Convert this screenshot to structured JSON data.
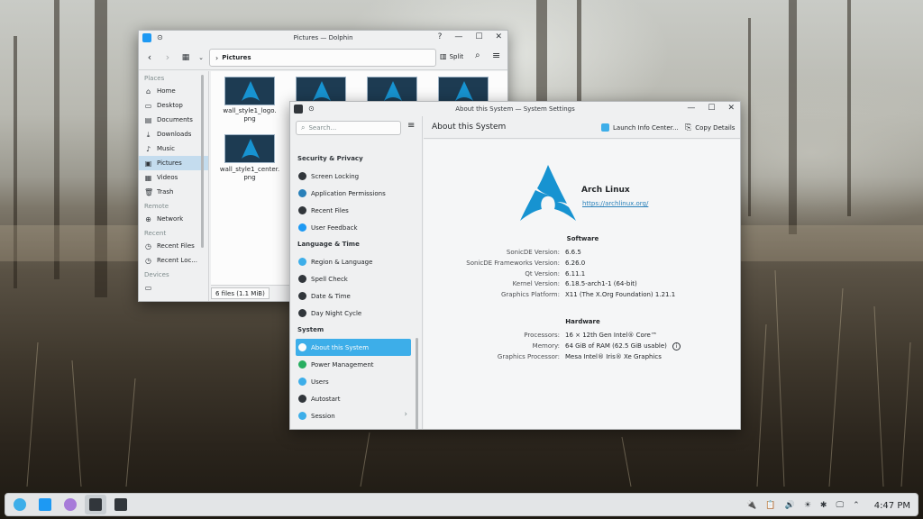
{
  "dolphin": {
    "title": "Pictures — Dolphin",
    "help": "?",
    "minimize": "—",
    "maximize": "☐",
    "close": "✕",
    "back": "‹",
    "forward": "›",
    "location": "Pictures",
    "split_label": "Split",
    "places": [
      {
        "type": "section",
        "label": "Places"
      },
      {
        "type": "item",
        "label": "Home",
        "icon": "home-icon",
        "glyph": "⌂"
      },
      {
        "type": "item",
        "label": "Desktop",
        "icon": "desktop-icon",
        "glyph": "▭"
      },
      {
        "type": "item",
        "label": "Documents",
        "icon": "documents-icon",
        "glyph": "▤"
      },
      {
        "type": "item",
        "label": "Downloads",
        "icon": "downloads-icon",
        "glyph": "⤓"
      },
      {
        "type": "item",
        "label": "Music",
        "icon": "music-icon",
        "glyph": "♪"
      },
      {
        "type": "item",
        "label": "Pictures",
        "icon": "pictures-icon",
        "glyph": "▣",
        "active": true
      },
      {
        "type": "item",
        "label": "Videos",
        "icon": "videos-icon",
        "glyph": "▦"
      },
      {
        "type": "item",
        "label": "Trash",
        "icon": "trash-icon",
        "glyph": "🗑"
      },
      {
        "type": "section",
        "label": "Remote"
      },
      {
        "type": "item",
        "label": "Network",
        "icon": "network-icon",
        "glyph": "⊕"
      },
      {
        "type": "section",
        "label": "Recent"
      },
      {
        "type": "item",
        "label": "Recent Files",
        "icon": "recent-files-icon",
        "glyph": "◷"
      },
      {
        "type": "item",
        "label": "Recent Loc...",
        "icon": "recent-locations-icon",
        "glyph": "◷"
      },
      {
        "type": "section",
        "label": "Devices"
      },
      {
        "type": "item",
        "label": "",
        "icon": "drive-icon",
        "glyph": "▭"
      }
    ],
    "files": [
      {
        "name": "wall_style1_logo.\npng"
      },
      {
        "name": ""
      },
      {
        "name": ""
      },
      {
        "name": ""
      },
      {
        "name": "wall_style1_center.\npng"
      }
    ],
    "status": "6 files (1.1 MiB)"
  },
  "settings": {
    "title": "About this System — System Settings",
    "minimize": "—",
    "maximize": "☐",
    "close": "✕",
    "search_placeholder": "Search...",
    "page_title": "About this System",
    "launch_info": "Launch Info Center...",
    "copy_details": "Copy Details",
    "sidebar": [
      {
        "type": "cat",
        "label": "Security & Privacy"
      },
      {
        "type": "item",
        "label": "Screen Locking",
        "name": "screen-locking",
        "icon": "screen-lock-icon",
        "color": "#31363b"
      },
      {
        "type": "item",
        "label": "Application Permissions",
        "name": "application-permissions",
        "icon": "shield-icon",
        "color": "#2980b9"
      },
      {
        "type": "item",
        "label": "Recent Files",
        "name": "recent-files",
        "icon": "clock-icon",
        "color": "#31363b"
      },
      {
        "type": "item",
        "label": "User Feedback",
        "name": "user-feedback",
        "icon": "feedback-icon",
        "color": "#1d99f3"
      },
      {
        "type": "cat",
        "label": "Language & Time"
      },
      {
        "type": "item",
        "label": "Region & Language",
        "name": "region-language",
        "icon": "flag-icon",
        "color": "#3daee9"
      },
      {
        "type": "item",
        "label": "Spell Check",
        "name": "spell-check",
        "icon": "spell-check-icon",
        "color": "#31363b"
      },
      {
        "type": "item",
        "label": "Date & Time",
        "name": "date-time",
        "icon": "clock-icon",
        "color": "#31363b"
      },
      {
        "type": "item",
        "label": "Day Night Cycle",
        "name": "day-night-cycle",
        "icon": "day-night-icon",
        "color": "#31363b"
      },
      {
        "type": "cat",
        "label": "System"
      },
      {
        "type": "item",
        "label": "About this System",
        "name": "about-this-system",
        "icon": "info-icon",
        "color": "#fcfcfc",
        "active": true
      },
      {
        "type": "item",
        "label": "Power Management",
        "name": "power-management",
        "icon": "power-icon",
        "color": "#27ae60"
      },
      {
        "type": "item",
        "label": "Users",
        "name": "users",
        "icon": "users-icon",
        "color": "#3daee9"
      },
      {
        "type": "item",
        "label": "Autostart",
        "name": "autostart",
        "icon": "autostart-icon",
        "color": "#31363b"
      },
      {
        "type": "item",
        "label": "Session",
        "name": "session",
        "icon": "session-icon",
        "color": "#3daee9",
        "chevron": true
      }
    ],
    "distro_name": "Arch Linux",
    "distro_url": "https://archlinux.org/",
    "software_title": "Software",
    "software": [
      {
        "k": "SonicDE Version:",
        "v": "6.6.5"
      },
      {
        "k": "SonicDE Frameworks Version:",
        "v": "6.26.0"
      },
      {
        "k": "Qt Version:",
        "v": "6.11.1"
      },
      {
        "k": "Kernel Version:",
        "v": "6.18.5-arch1-1 (64-bit)"
      },
      {
        "k": "Graphics Platform:",
        "v": "X11 (The X.Org Foundation) 1.21.1"
      }
    ],
    "hardware_title": "Hardware",
    "hardware": [
      {
        "k": "Processors:",
        "v": "16 × 12th Gen Intel® Core™"
      },
      {
        "k": "Memory:",
        "v": "64 GiB of RAM (62.5 GiB usable)",
        "info": true
      },
      {
        "k": "Graphics Processor:",
        "v": "Mesa Intel® Iris® Xe Graphics"
      }
    ]
  },
  "taskbar": {
    "apps": [
      {
        "name": "app-launcher",
        "icon": "launcher-icon",
        "color": "#3daee9"
      },
      {
        "name": "dolphin-task",
        "icon": "folder-icon",
        "color": "#1d99f3"
      },
      {
        "name": "browser-task",
        "icon": "browser-icon",
        "color": "#a77bd9"
      },
      {
        "name": "settings-task",
        "icon": "settings-window-icon",
        "color": "#31363b",
        "active": true
      },
      {
        "name": "terminal-task",
        "icon": "terminal-icon",
        "color": "#31363b"
      }
    ],
    "tray": [
      "🔌",
      "📋",
      "🔊",
      "☀",
      "✱",
      "🖵",
      "⌃"
    ],
    "clock": "4:47 PM"
  },
  "colors": {
    "accent": "#3daee9",
    "arch_blue": "#1793d1"
  }
}
